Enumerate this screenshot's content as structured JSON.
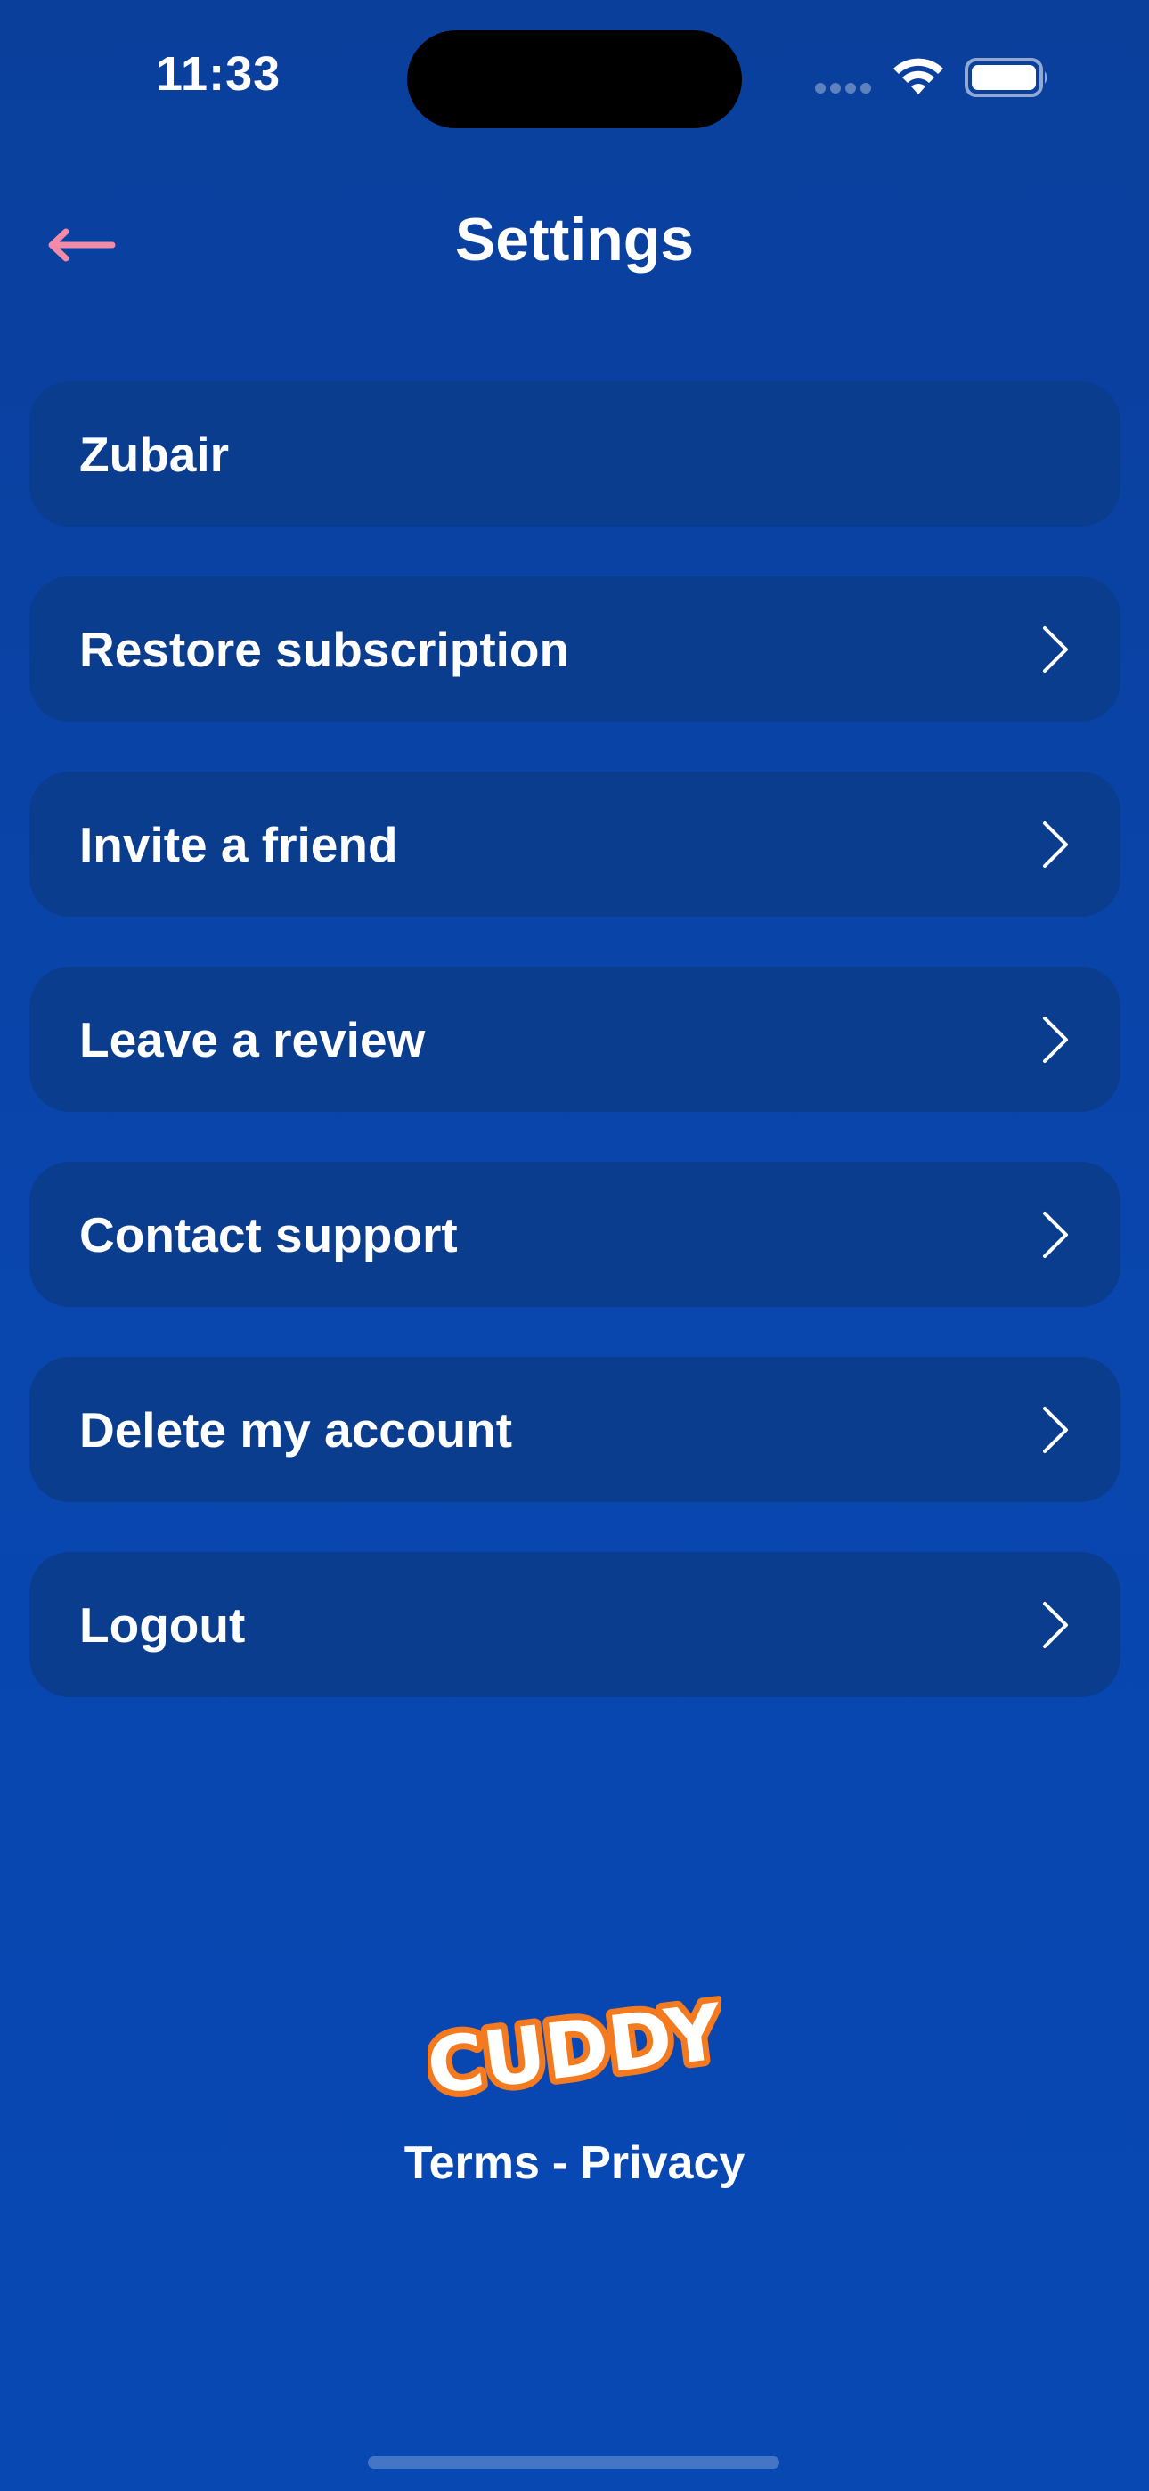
{
  "status_bar": {
    "time": "11:33",
    "icons": [
      "signal-icon",
      "wifi-icon",
      "battery-icon"
    ]
  },
  "header": {
    "title": "Settings",
    "back_icon": "arrow-left-icon",
    "back_icon_color": "#f28aa8"
  },
  "settings": {
    "items": [
      {
        "label": "Zubair",
        "has_chevron": false
      },
      {
        "label": "Restore subscription",
        "has_chevron": true
      },
      {
        "label": "Invite a friend",
        "has_chevron": true
      },
      {
        "label": "Leave a review",
        "has_chevron": true
      },
      {
        "label": "Contact support",
        "has_chevron": true
      },
      {
        "label": "Delete my account",
        "has_chevron": true
      },
      {
        "label": "Logout",
        "has_chevron": true
      }
    ]
  },
  "footer": {
    "logo_text": "CUDDY",
    "terms_label": "Terms",
    "separator": "-",
    "privacy_label": "Privacy"
  },
  "colors": {
    "background": "#0946ae",
    "card": "#0b3d8f",
    "logo_orange": "#f47a20",
    "accent_pink": "#f28aa8"
  }
}
